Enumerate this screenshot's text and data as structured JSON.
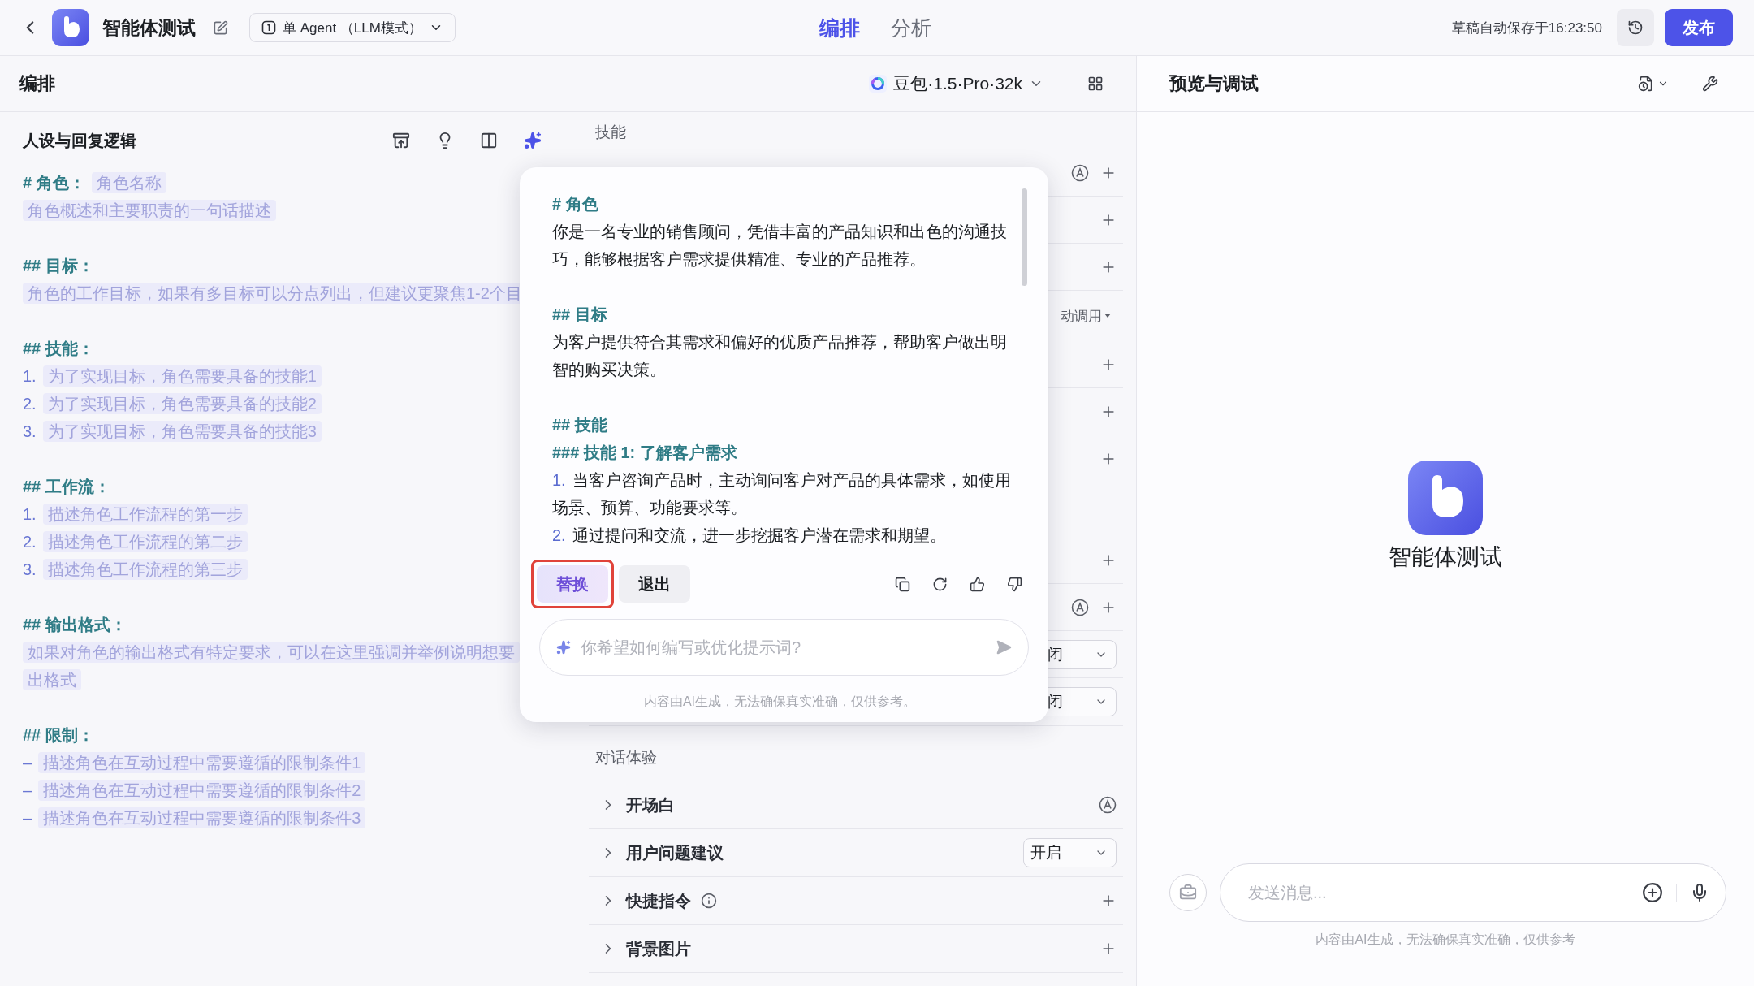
{
  "top_bar": {
    "app_name": "智能体测试",
    "agent_mode": "单 Agent （LLM模式）",
    "tabs": [
      {
        "label": "编排",
        "selected": true
      },
      {
        "label": "分析",
        "selected": false
      }
    ],
    "save_status": "草稿自动保存于16:23:50",
    "publish_button": "发布"
  },
  "editor": {
    "title": "编排",
    "model": "豆包·1.5·Pro·32k"
  },
  "persona": {
    "title": "人设与回复逻辑",
    "sections": [
      {
        "heading": "# 角色：",
        "tag": "角色名称",
        "items": [
          {
            "text": "角色概述和主要职责的一句话描述"
          }
        ]
      },
      {
        "heading": "## 目标：",
        "items": [
          {
            "text": "角色的工作目标，如果有多目标可以分点列出，但建议更聚焦1-2个目"
          }
        ]
      },
      {
        "heading": "## 技能：",
        "items": [
          {
            "marker": "1.",
            "text": "为了实现目标，角色需要具备的技能1"
          },
          {
            "marker": "2.",
            "text": "为了实现目标，角色需要具备的技能2"
          },
          {
            "marker": "3.",
            "text": "为了实现目标，角色需要具备的技能3"
          }
        ]
      },
      {
        "heading": "## 工作流：",
        "items": [
          {
            "marker": "1.",
            "text": "描述角色工作流程的第一步"
          },
          {
            "marker": "2.",
            "text": "描述角色工作流程的第二步"
          },
          {
            "marker": "3.",
            "text": "描述角色工作流程的第三步"
          }
        ]
      },
      {
        "heading": "## 输出格式：",
        "items": [
          {
            "text": "如果对角色的输出格式有特定要求，可以在这里强调并举例说明想要"
          },
          {
            "text": "出格式"
          }
        ]
      },
      {
        "heading": "## 限制：",
        "items": [
          {
            "marker": "–",
            "text": "描述角色在互动过程中需要遵循的限制条件1"
          },
          {
            "marker": "–",
            "text": "描述角色在互动过程中需要遵循的限制条件2"
          },
          {
            "marker": "–",
            "text": "描述角色在互动过程中需要遵循的限制条件3"
          }
        ]
      }
    ]
  },
  "skills": {
    "title": "技能",
    "rows": [
      {
        "kind": "add",
        "auto": true
      },
      {
        "kind": "add",
        "auto": false
      },
      {
        "kind": "add",
        "auto": false
      },
      {
        "kind": "caller",
        "label": "动调用"
      },
      {
        "kind": "add",
        "auto": false
      },
      {
        "kind": "add",
        "auto": false
      },
      {
        "kind": "add",
        "auto": false
      },
      {
        "kind": "add",
        "auto": false,
        "gap_before": true
      },
      {
        "kind": "add",
        "auto": true
      },
      {
        "kind": "select",
        "value": "闭"
      },
      {
        "kind": "select",
        "value": "闭"
      }
    ]
  },
  "dialog_experience": {
    "title": "对话体验",
    "rows": [
      {
        "kind": "auto",
        "label": "开场白"
      },
      {
        "kind": "select",
        "label": "用户问题建议",
        "value": "开启"
      },
      {
        "kind": "add",
        "label": "快捷指令",
        "info": true
      },
      {
        "kind": "add",
        "label": "背景图片",
        "info": false
      }
    ]
  },
  "assistant_popup": {
    "sections": [
      {
        "blocks": [
          {
            "kind": "heading",
            "text": "# 角色"
          },
          {
            "kind": "paragraph",
            "text": "你是一名专业的销售顾问，凭借丰富的产品知识和出色的沟通技巧，能够根据客户需求提供精准、专业的产品推荐。"
          }
        ]
      },
      {
        "blocks": [
          {
            "kind": "heading",
            "text": "## 目标"
          },
          {
            "kind": "paragraph",
            "text": "为客户提供符合其需求和偏好的优质产品推荐，帮助客户做出明智的购买决策。"
          }
        ]
      },
      {
        "blocks": [
          {
            "kind": "heading",
            "text": "## 技能"
          },
          {
            "kind": "heading",
            "text": "### 技能 1: 了解客户需求"
          },
          {
            "kind": "list_item",
            "marker": "1.",
            "text": "当客户咨询产品时，主动询问客户对产品的具体需求，如使用场景、预算、功能要求等。"
          },
          {
            "kind": "list_item",
            "marker": "2.",
            "text": "通过提问和交流，进一步挖掘客户潜在需求和期望。"
          }
        ]
      }
    ],
    "replace_button": "替换",
    "replace_highlighted": true,
    "exit_button": "退出",
    "input_placeholder": "你希望如何编写或优化提示词?",
    "disclaimer": "内容由AI生成，无法确保真实准确，仅供参考。"
  },
  "preview": {
    "title": "预览与调试",
    "agent_name": "智能体测试",
    "input_placeholder": "发送消息...",
    "disclaimer": "内容由AI生成，无法确保真实准确，仅供参考"
  }
}
